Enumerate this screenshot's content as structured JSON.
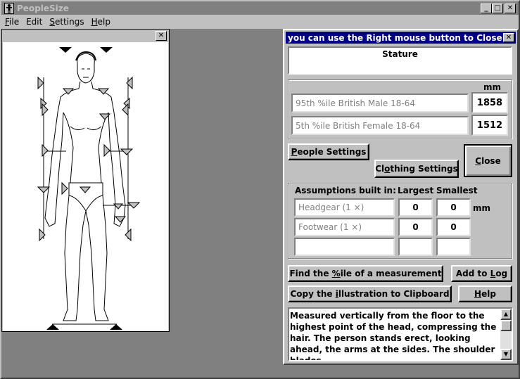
{
  "app": {
    "title": "PeopleSize"
  },
  "menu": {
    "file": "File",
    "edit": "Edit",
    "settings": "Settings",
    "help": "Help"
  },
  "dialog": {
    "title": "you can use the Right mouse button to Close",
    "measurement_name": "Stature",
    "mm_label": "mm",
    "populations": [
      {
        "label": "95th %ile British Male 18-64",
        "value": "1858"
      },
      {
        "label": "5th %ile British Female 18-64",
        "value": "1512"
      }
    ],
    "people_settings": "People Settings",
    "clothing_settings": "Clothing Settings",
    "close": "Close",
    "assumptions": {
      "heading": "Assumptions built in:",
      "largest": "Largest",
      "smallest": "Smallest",
      "unit": "mm",
      "rows": [
        {
          "label": "Headgear  (1 ×)",
          "largest": "0",
          "smallest": "0"
        },
        {
          "label": "Footwear  (1 ×)",
          "largest": "0",
          "smallest": "0"
        },
        {
          "label": "",
          "largest": "",
          "smallest": ""
        }
      ]
    },
    "find_percentile": "Find the %ile of a measurement",
    "add_to_log": "Add to Log",
    "copy_illustration": "Copy the illustration to Clipboard",
    "help": "Help",
    "description": "Measured vertically from the floor to the highest point of the head, compressing the hair. The person stands erect, looking ahead, the arms at the sides. The shoulder blades"
  },
  "icons": {
    "app_icon": "person-icon",
    "close": "close-icon",
    "minimize": "minimize-icon",
    "maximize": "maximize-icon"
  }
}
